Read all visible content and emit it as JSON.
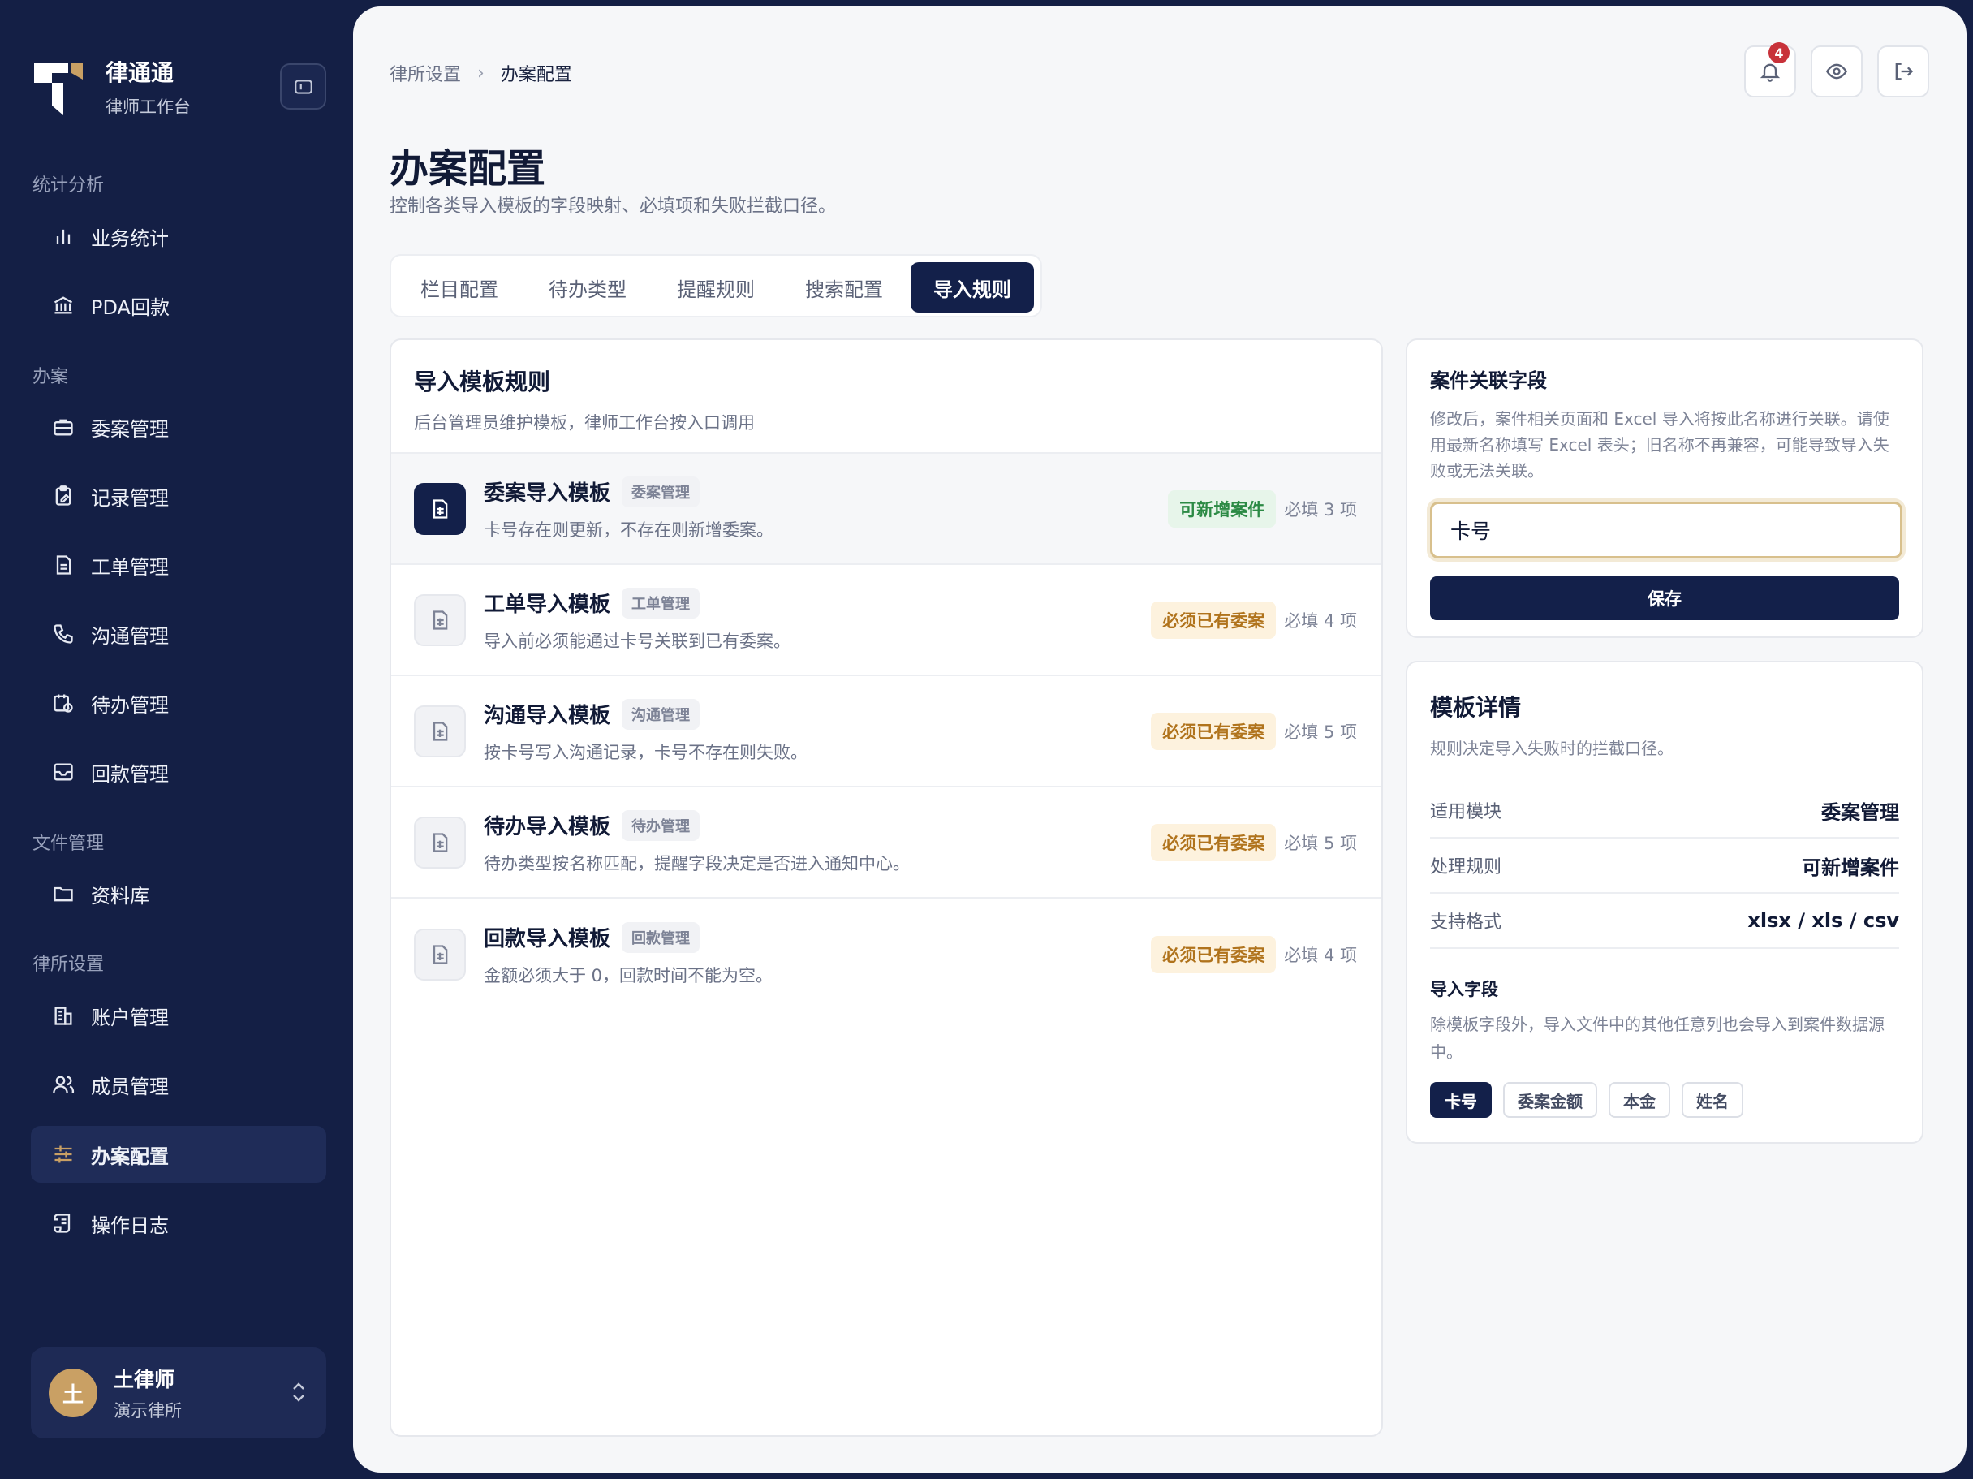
{
  "brand": {
    "name": "律通通",
    "sub": "律师工作台"
  },
  "sidebar": {
    "sections": [
      {
        "label": "统计分析"
      },
      {
        "label": "办案"
      },
      {
        "label": "文件管理"
      },
      {
        "label": "律所设置"
      }
    ],
    "items": [
      {
        "label": "业务统计",
        "icon": "bar-chart-icon"
      },
      {
        "label": "PDA回款",
        "icon": "bank-icon"
      },
      {
        "label": "委案管理",
        "icon": "briefcase-icon"
      },
      {
        "label": "记录管理",
        "icon": "clipboard-edit-icon"
      },
      {
        "label": "工单管理",
        "icon": "document-icon"
      },
      {
        "label": "沟通管理",
        "icon": "phone-icon"
      },
      {
        "label": "待办管理",
        "icon": "calendar-clock-icon"
      },
      {
        "label": "回款管理",
        "icon": "inbox-icon"
      },
      {
        "label": "资料库",
        "icon": "folder-icon"
      },
      {
        "label": "账户管理",
        "icon": "building-icon"
      },
      {
        "label": "成员管理",
        "icon": "users-icon"
      },
      {
        "label": "办案配置",
        "icon": "sliders-icon",
        "active": true
      },
      {
        "label": "操作日志",
        "icon": "scroll-icon"
      }
    ]
  },
  "user": {
    "avatar": "土",
    "name": "土律师",
    "firm": "演示律所"
  },
  "header": {
    "breadcrumb_parent": "律所设置",
    "breadcrumb_current": "办案配置",
    "notification_count": "4"
  },
  "page": {
    "title": "办案配置",
    "description": "控制各类导入模板的字段映射、必填项和失败拦截口径。"
  },
  "tabs": [
    {
      "label": "栏目配置"
    },
    {
      "label": "待办类型"
    },
    {
      "label": "提醒规则"
    },
    {
      "label": "搜索配置"
    },
    {
      "label": "导入规则",
      "active": true
    }
  ],
  "rules_list": {
    "title": "导入模板规则",
    "subtitle": "后台管理员维护模板，律师工作台按入口调用",
    "rows": [
      {
        "name": "委案导入模板",
        "module": "委案管理",
        "desc": "卡号存在则更新，不存在则新增委案。",
        "tag": "可新增案件",
        "tag_color": "green",
        "required": "必填 3 项",
        "selected": true
      },
      {
        "name": "工单导入模板",
        "module": "工单管理",
        "desc": "导入前必须能通过卡号关联到已有委案。",
        "tag": "必须已有委案",
        "tag_color": "orange",
        "required": "必填 4 项"
      },
      {
        "name": "沟通导入模板",
        "module": "沟通管理",
        "desc": "按卡号写入沟通记录，卡号不存在则失败。",
        "tag": "必须已有委案",
        "tag_color": "orange",
        "required": "必填 5 项"
      },
      {
        "name": "待办导入模板",
        "module": "待办管理",
        "desc": "待办类型按名称匹配，提醒字段决定是否进入通知中心。",
        "tag": "必须已有委案",
        "tag_color": "orange",
        "required": "必填 5 项"
      },
      {
        "name": "回款导入模板",
        "module": "回款管理",
        "desc": "金额必须大于 0，回款时间不能为空。",
        "tag": "必须已有委案",
        "tag_color": "orange",
        "required": "必填 4 项"
      }
    ]
  },
  "field_card": {
    "title": "案件关联字段",
    "desc": "修改后，案件相关页面和 Excel 导入将按此名称进行关联。请使用最新名称填写 Excel 表头；旧名称不再兼容，可能导致导入失败或无法关联。",
    "value": "卡号",
    "save_label": "保存"
  },
  "detail_card": {
    "title": "模板详情",
    "subtitle": "规则决定导入失败时的拦截口径。",
    "rows": [
      {
        "label": "适用模块",
        "value": "委案管理"
      },
      {
        "label": "处理规则",
        "value": "可新增案件"
      },
      {
        "label": "支持格式",
        "value": "xlsx / xls / csv"
      }
    ],
    "import_title": "导入字段",
    "import_desc": "除模板字段外，导入文件中的其他任意列也会导入到案件数据源中。",
    "chips": [
      {
        "label": "卡号",
        "active": true
      },
      {
        "label": "委案金额"
      },
      {
        "label": "本金"
      },
      {
        "label": "姓名"
      }
    ]
  },
  "colors": {
    "sidebar_bg": "#141f45",
    "accent_navy": "#13204a",
    "accent_gold": "#c9a064",
    "green_tag": "#2c8a45",
    "orange_tag": "#b0731c",
    "badge_red": "#c8323a"
  }
}
